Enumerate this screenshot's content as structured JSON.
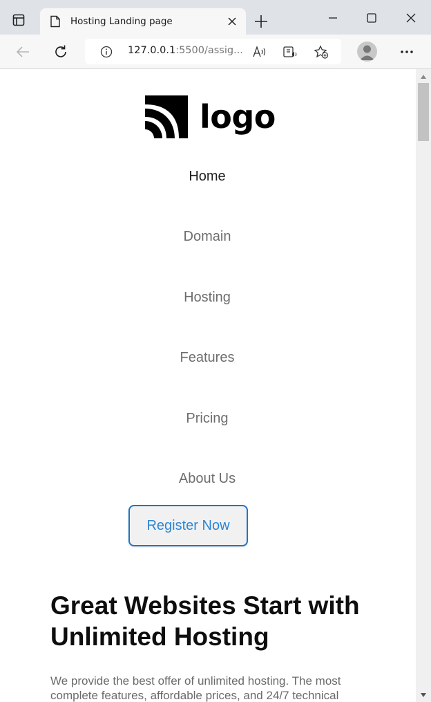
{
  "browser": {
    "tab_title": "Hosting Landing page",
    "url_host": "127.0.0.1",
    "url_rest": ":5500/assig...",
    "icons": [
      "tab-actions-icon",
      "page-icon",
      "close-icon",
      "plus-icon",
      "minimize-icon",
      "maximize-icon",
      "close-window-icon",
      "back-arrow-icon",
      "refresh-icon",
      "info-icon",
      "read-aloud-icon",
      "immersive-reader-icon",
      "favorites-add-icon",
      "profile-avatar-icon",
      "more-icon"
    ]
  },
  "site": {
    "logo_text": "logo",
    "nav": [
      {
        "label": "Home",
        "active": true
      },
      {
        "label": "Domain",
        "active": false
      },
      {
        "label": "Hosting",
        "active": false
      },
      {
        "label": "Features",
        "active": false
      },
      {
        "label": "Pricing",
        "active": false
      },
      {
        "label": "About Us",
        "active": false
      }
    ],
    "register_label": "Register Now",
    "hero_title": "Great Websites Start with Unlimited Hosting",
    "hero_description": "We provide the best offer of unlimited hosting. The most complete features, affordable prices, and 24/7 technical"
  },
  "colors": {
    "chrome_bg": "#dfe3e8",
    "toolbar_bg": "#f7f7f7",
    "accent": "#2c85d3",
    "nav_text": "#6d6d6d",
    "nav_active": "#1f1f1f"
  }
}
